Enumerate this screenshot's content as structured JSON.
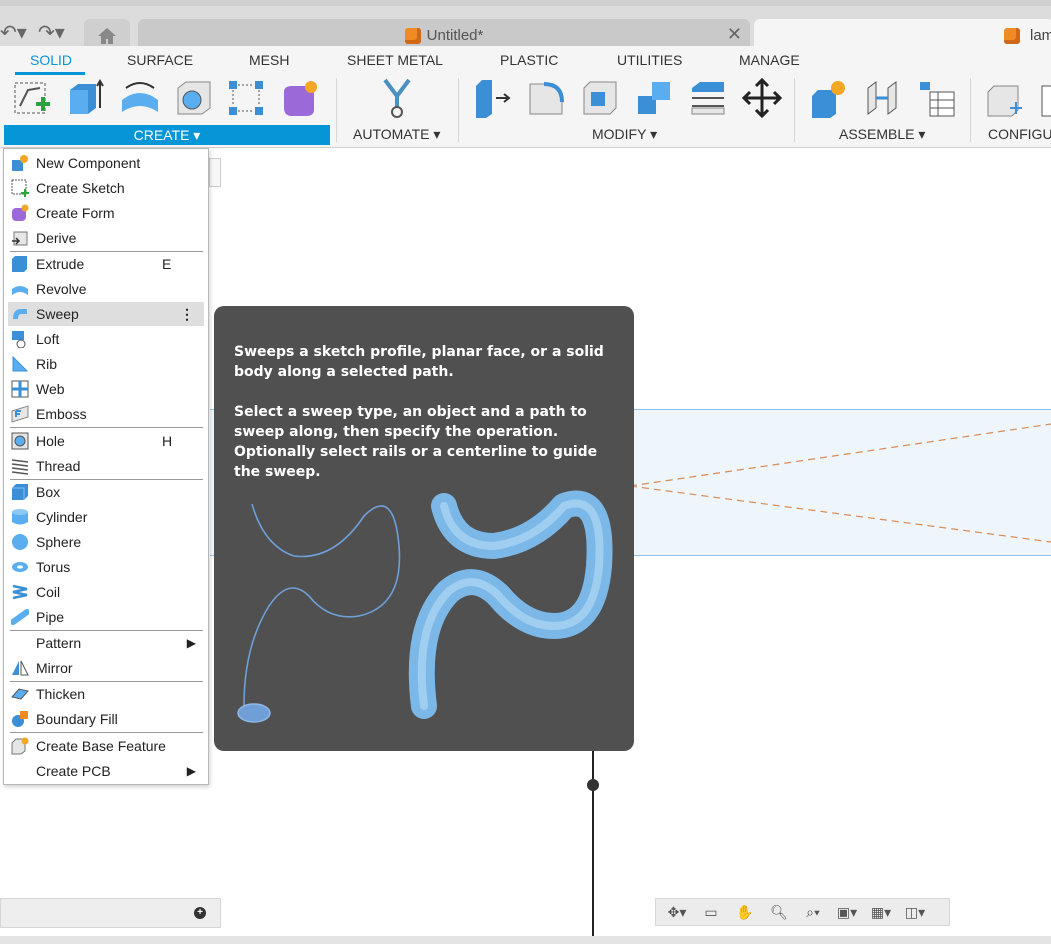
{
  "titlebar": {
    "doc_tab_title": "Untitled*",
    "second_tab_title": "lam"
  },
  "ribbon": {
    "tabs": [
      "SOLID",
      "SURFACE",
      "MESH",
      "SHEET METAL",
      "PLASTIC",
      "UTILITIES",
      "MANAGE"
    ],
    "active_tab": "SOLID",
    "groups": {
      "create": "CREATE ▾",
      "automate": "AUTOMATE ▾",
      "modify": "MODIFY ▾",
      "assemble": "ASSEMBLE ▾",
      "configure": "CONFIGU"
    }
  },
  "menu": {
    "items": [
      {
        "label": "New Component",
        "icon": "new-component-icon"
      },
      {
        "label": "Create Sketch",
        "icon": "create-sketch-icon"
      },
      {
        "label": "Create Form",
        "icon": "create-form-icon"
      },
      {
        "label": "Derive",
        "icon": "derive-icon"
      },
      {
        "label": "Extrude",
        "icon": "extrude-icon",
        "shortcut": "E"
      },
      {
        "label": "Revolve",
        "icon": "revolve-icon"
      },
      {
        "label": "Sweep",
        "icon": "sweep-icon"
      },
      {
        "label": "Loft",
        "icon": "loft-icon"
      },
      {
        "label": "Rib",
        "icon": "rib-icon"
      },
      {
        "label": "Web",
        "icon": "web-icon"
      },
      {
        "label": "Emboss",
        "icon": "emboss-icon"
      },
      {
        "label": "Hole",
        "icon": "hole-icon",
        "shortcut": "H"
      },
      {
        "label": "Thread",
        "icon": "thread-icon"
      },
      {
        "label": "Box",
        "icon": "box-icon"
      },
      {
        "label": "Cylinder",
        "icon": "cylinder-icon"
      },
      {
        "label": "Sphere",
        "icon": "sphere-icon"
      },
      {
        "label": "Torus",
        "icon": "torus-icon"
      },
      {
        "label": "Coil",
        "icon": "coil-icon"
      },
      {
        "label": "Pipe",
        "icon": "pipe-icon"
      },
      {
        "label": "Pattern",
        "icon": ""
      },
      {
        "label": "Mirror",
        "icon": "mirror-icon"
      },
      {
        "label": "Thicken",
        "icon": "thicken-icon"
      },
      {
        "label": "Boundary Fill",
        "icon": "boundary-fill-icon"
      },
      {
        "label": "Create Base Feature",
        "icon": "base-feature-icon"
      },
      {
        "label": "Create PCB",
        "icon": ""
      }
    ],
    "highlighted": "Sweep"
  },
  "tooltip": {
    "paragraph1": "Sweeps a sketch profile, planar face, or a solid body along a selected path.",
    "paragraph2": "Select a sweep type, an object and a path to sweep along, then specify the operation. Optionally select rails or a centerline to guide the sweep."
  },
  "colors": {
    "accent": "#0696d7",
    "tooltip_bg": "#505050",
    "menu_highlight": "#dedede"
  }
}
